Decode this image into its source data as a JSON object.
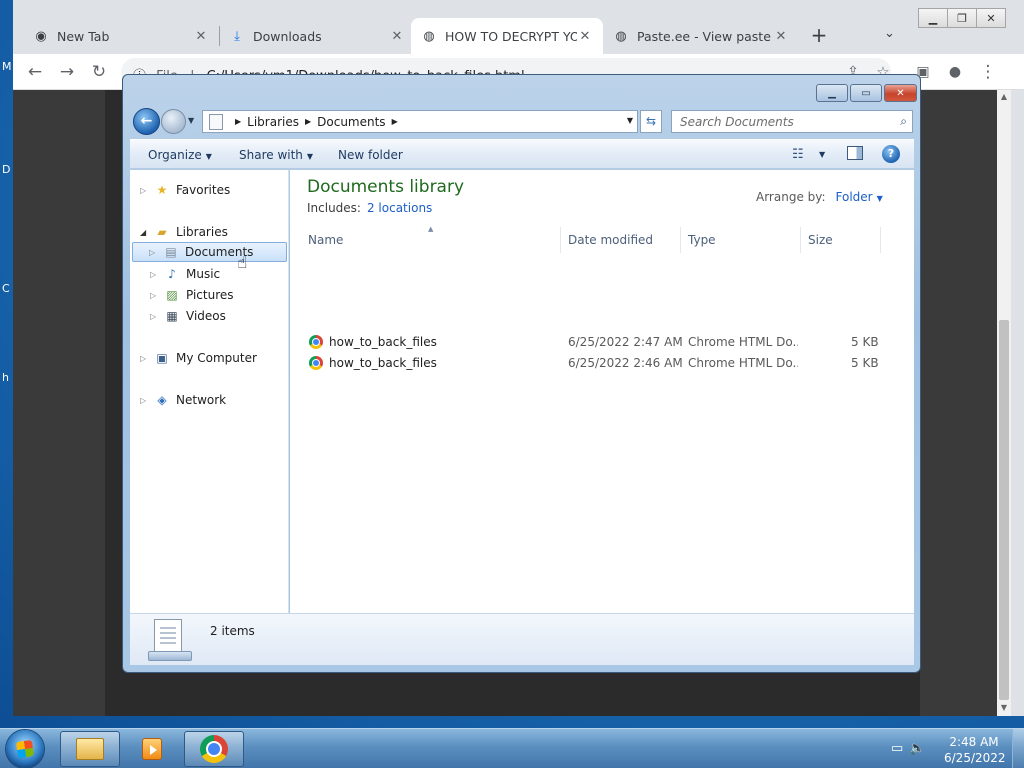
{
  "browser": {
    "tabs": [
      {
        "title": "New Tab",
        "icon": "chrome-icon"
      },
      {
        "title": "Downloads",
        "icon": "download-icon"
      },
      {
        "title": "HOW TO DECRYPT YOUR",
        "icon": "globe-icon",
        "active": true
      },
      {
        "title": "Paste.ee - View paste Lo",
        "icon": "globe-icon"
      }
    ],
    "new_tab_label": "+",
    "url_scheme": "File",
    "url": "C:/Users/vm1/Downloads/how_to_back_files.html"
  },
  "desktop_letters": [
    "M",
    "D",
    "C",
    "h"
  ],
  "explorer": {
    "breadcrumb": [
      "Libraries",
      "Documents"
    ],
    "search_placeholder": "Search Documents",
    "commands": {
      "organize": "Organize",
      "share_with": "Share with",
      "new_folder": "New folder"
    },
    "nav_tree": {
      "favorites": "Favorites",
      "libraries": "Libraries",
      "library_items": [
        "Documents",
        "Music",
        "Pictures",
        "Videos"
      ],
      "computer": "My Computer",
      "network": "Network"
    },
    "library": {
      "title": "Documents library",
      "includes_label": "Includes:",
      "includes_link": "2 locations",
      "arrange_label": "Arrange by:",
      "arrange_value": "Folder"
    },
    "columns": [
      "Name",
      "Date modified",
      "Type",
      "Size"
    ],
    "files": [
      {
        "name": "how_to_back_files",
        "date": "6/25/2022 2:47 AM",
        "type": "Chrome HTML Do...",
        "size": "5 KB"
      },
      {
        "name": "how_to_back_files",
        "date": "6/25/2022 2:46 AM",
        "type": "Chrome HTML Do...",
        "size": "5 KB"
      }
    ],
    "item_count": "2 items"
  },
  "taskbar": {
    "time": "2:48 AM",
    "date": "6/25/2022"
  },
  "colors": {
    "library_title": "#1e6a1e",
    "link": "#1d5ec9",
    "selection": "#c9e1fa"
  }
}
